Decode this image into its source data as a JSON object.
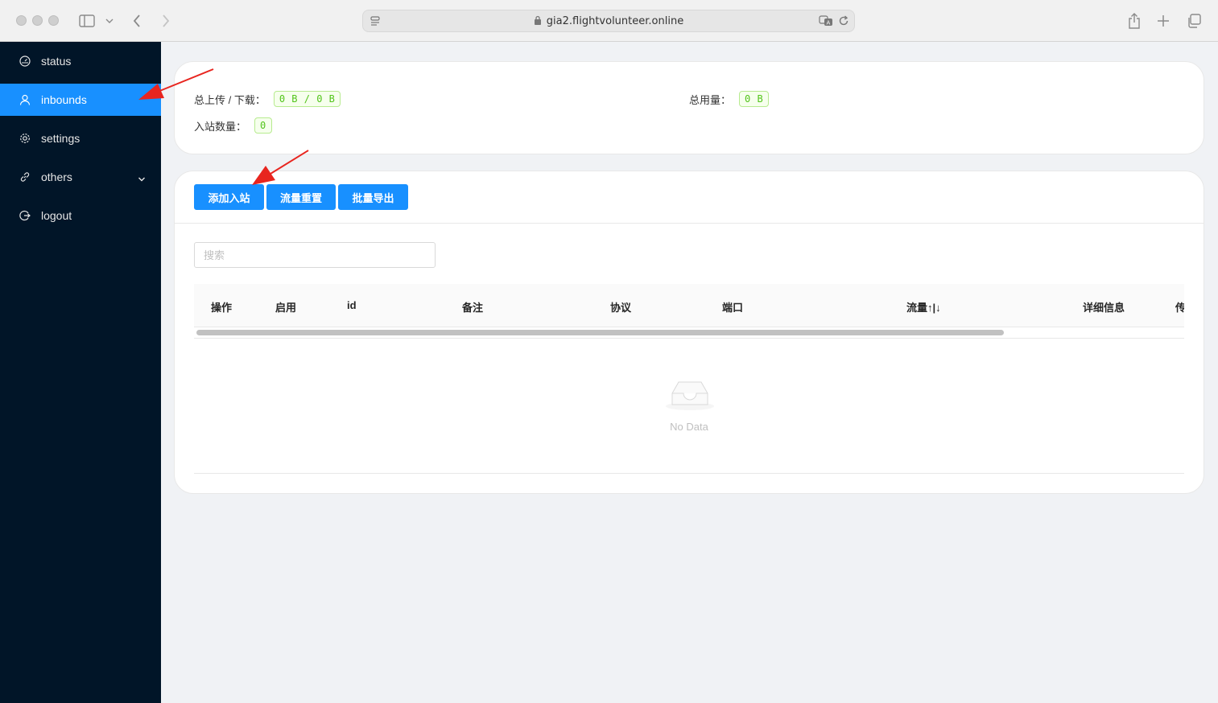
{
  "browser": {
    "url": "gia2.flightvolunteer.online"
  },
  "sidebar": {
    "items": [
      {
        "label": "status",
        "icon": "dashboard-icon"
      },
      {
        "label": "inbounds",
        "icon": "user-icon",
        "active": true
      },
      {
        "label": "settings",
        "icon": "gear-icon"
      },
      {
        "label": "others",
        "icon": "link-icon"
      },
      {
        "label": "logout",
        "icon": "logout-icon"
      }
    ]
  },
  "stats": {
    "traffic_label": "总上传 / 下载：",
    "traffic_value": "0 B / 0 B",
    "usage_label": "总用量：",
    "usage_value": "0 B",
    "count_label": "入站数量：",
    "count_value": "0"
  },
  "toolbar": {
    "add_label": "添加入站",
    "reset_label": "流量重置",
    "export_label": "批量导出"
  },
  "search": {
    "placeholder": "搜索"
  },
  "table": {
    "columns": [
      "操作",
      "启用",
      "id",
      "备注",
      "协议",
      "端口",
      "流量↑|↓",
      "详细信息",
      "传"
    ],
    "empty_text": "No Data"
  },
  "colors": {
    "sidebar_bg": "#011528",
    "accent": "#1890ff",
    "tag_green": "#52c41a",
    "annotation_arrow": "#e8251f"
  }
}
